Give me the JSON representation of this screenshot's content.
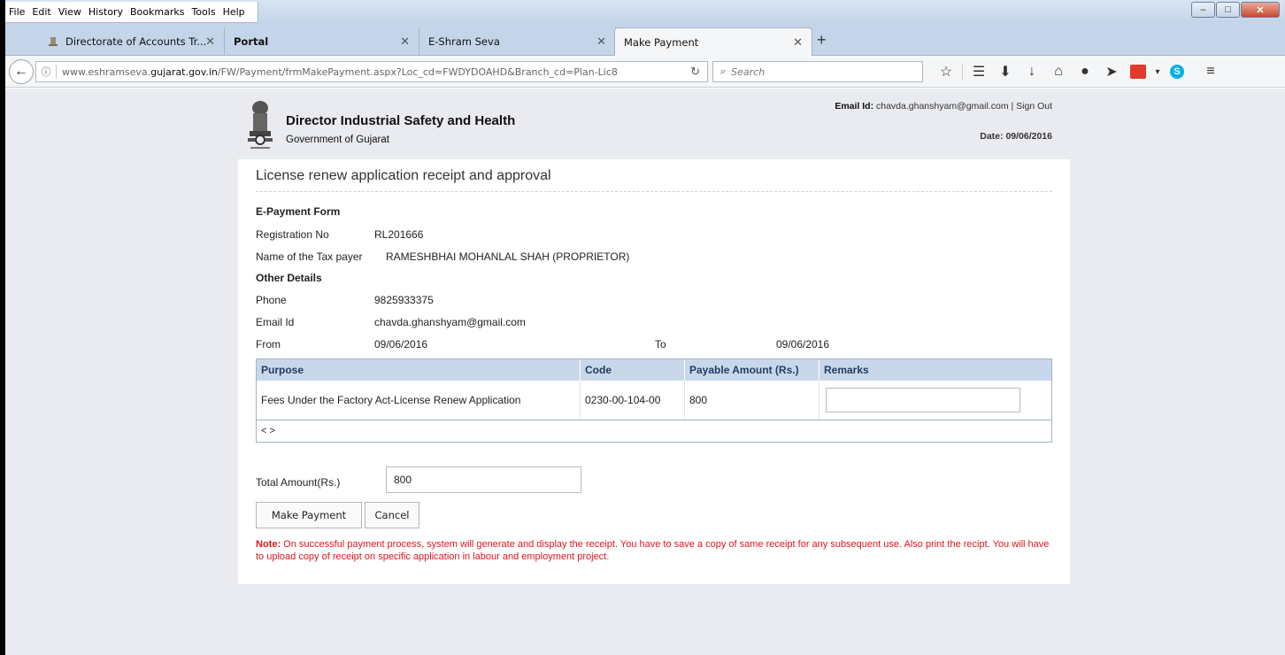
{
  "browser": {
    "menu": [
      "File",
      "Edit",
      "View",
      "History",
      "Bookmarks",
      "Tools",
      "Help"
    ],
    "tabs": [
      {
        "title": "Directorate of Accounts Tr...",
        "active": false
      },
      {
        "title": "Portal",
        "active": false
      },
      {
        "title": "E-Shram Seva",
        "active": false
      },
      {
        "title": "Make Payment",
        "active": true
      }
    ],
    "url_prefix": "www.eshramseva.",
    "url_domain": "gujarat.gov.in",
    "url_path": "/FW/Payment/frmMakePayment.aspx?Loc_cd=FWDYDOAHD&Branch_cd=Plan-Lic8",
    "search_placeholder": "Search"
  },
  "header": {
    "org_title": "Director Industrial Safety and Health",
    "org_sub": "Government of Gujarat",
    "email_label": "Email Id:",
    "email_value": "chavda.ghanshyam@gmail.com",
    "sign_out": "Sign Out",
    "date_label": "Date:",
    "date_value": "09/06/2016"
  },
  "form": {
    "title": "License renew application receipt and approval",
    "section_epay": "E-Payment Form",
    "reg_label": "Registration No",
    "reg_value": "RL201666",
    "name_label": "Name of the Tax payer",
    "name_value": "RAMESHBHAI MOHANLAL SHAH (PROPRIETOR)",
    "section_other": "Other Details",
    "phone_label": "Phone",
    "phone_value": "9825933375",
    "email_label": "Email Id",
    "email_value": "chavda.ghanshyam@gmail.com",
    "from_label": "From",
    "from_value": "09/06/2016",
    "to_label": "To",
    "to_value": "09/06/2016"
  },
  "table": {
    "headers": [
      "Purpose",
      "Code",
      "Payable Amount (Rs.)",
      "Remarks"
    ],
    "rows": [
      {
        "purpose": "Fees Under the Factory Act-License Renew Application",
        "code": "0230-00-104-00",
        "amount": "800",
        "remarks": ""
      }
    ],
    "pager": "< >"
  },
  "total": {
    "label": "Total Amount(Rs.)",
    "value": "800"
  },
  "buttons": {
    "pay": "Make Payment",
    "cancel": "Cancel"
  },
  "note": {
    "prefix": "Note:",
    "text": " On successful payment process, system will generate and display the receipt. You have to save a copy of same receipt for any subsequent use. Also print the recipt. You will have to upload copy of receipt on specific application in labour and employment project."
  }
}
